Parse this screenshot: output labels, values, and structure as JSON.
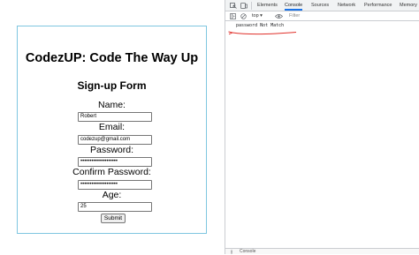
{
  "page": {
    "site_title": "CodezUP: Code The Way Up",
    "form_title": "Sign-up Form",
    "fields": [
      {
        "label": "Name:",
        "value": "Robert"
      },
      {
        "label": "Email:",
        "value": "codezup@gmail.com"
      },
      {
        "label": "Password:",
        "value": "••••••••••••••••••••"
      },
      {
        "label": "Confirm Password:",
        "value": "••••••••••••••••••••"
      },
      {
        "label": "Age:",
        "value": "25"
      }
    ],
    "submit_label": "Submit"
  },
  "devtools": {
    "tabs": [
      "Elements",
      "Console",
      "Sources",
      "Network",
      "Performance",
      "Memory"
    ],
    "active_tab": "Console",
    "context": "top ▾",
    "filter_placeholder": "Filter",
    "messages": [
      "password Not Match"
    ],
    "drawer_label": "Console"
  },
  "colors": {
    "form_border": "#7fc6e0",
    "annotation": "#e0302a",
    "active_tab": "#1a73e8"
  }
}
